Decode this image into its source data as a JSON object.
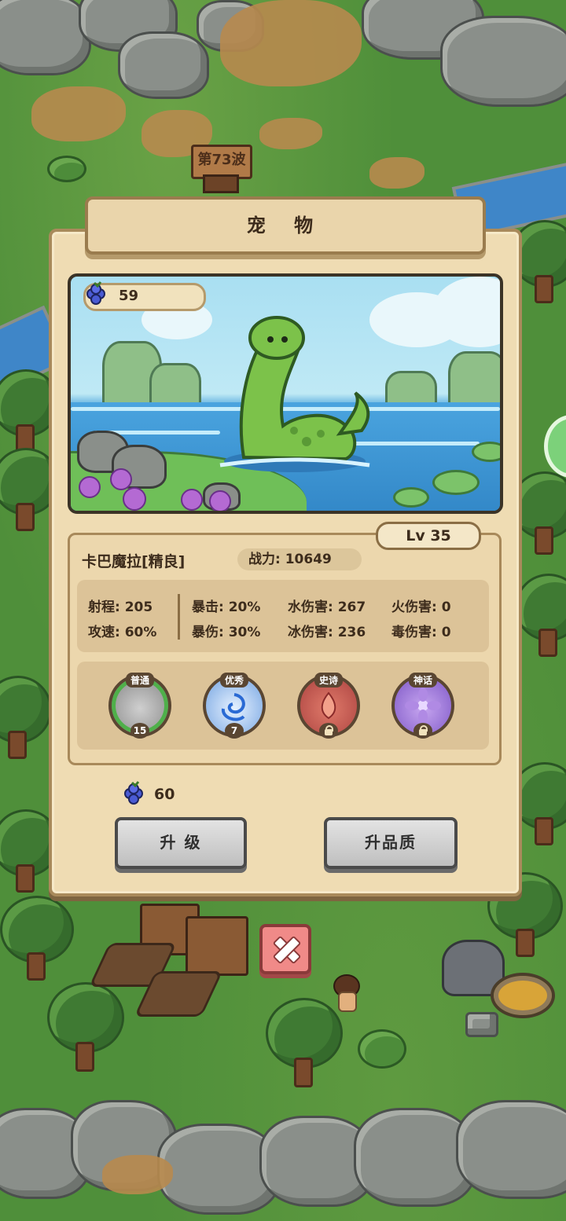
{
  "world": {
    "wave_label": "第73波"
  },
  "dialog": {
    "title": "宠 物",
    "berries_owned": "59",
    "level": "Lv 35",
    "pet_name": "卡巴魔拉[精良]",
    "power_label": "战力: 10649",
    "stats": {
      "range": "射程: 205",
      "attack_speed": "攻速: 60%",
      "crit": "暴击: 20%",
      "crit_damage": "暴伤: 30%",
      "water_damage": "水伤害: 267",
      "ice_damage": "冰伤害: 236",
      "fire_damage": "火伤害: 0",
      "poison_damage": "毒伤害: 0"
    },
    "tiers": [
      {
        "label": "普通",
        "count": "15",
        "locked": false
      },
      {
        "label": "优秀",
        "count": "7",
        "locked": false
      },
      {
        "label": "史诗",
        "count": "",
        "locked": true
      },
      {
        "label": "神话",
        "count": "",
        "locked": true
      }
    ],
    "upgrade_cost": "60",
    "buttons": {
      "upgrade": "升 级",
      "upgrade_quality": "升品质"
    }
  },
  "icons": [
    "berry-icon",
    "lock-icon",
    "close-icon"
  ],
  "colors": {
    "panel": "#efdcb3",
    "close_button": "#f08a88",
    "button_gray": "#d2d2d2"
  }
}
